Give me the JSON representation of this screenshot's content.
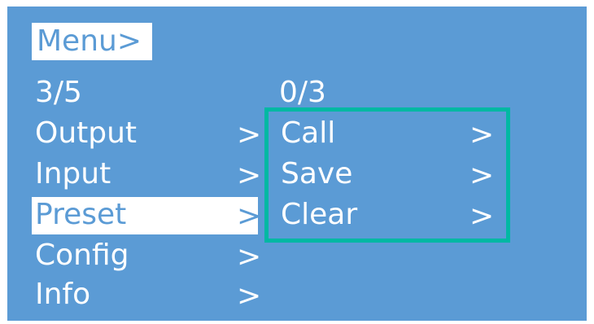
{
  "menu": {
    "title": "Menu>",
    "counter": "3/5",
    "items": [
      {
        "label": "Output",
        "arrow": ">"
      },
      {
        "label": "Input",
        "arrow": ">"
      },
      {
        "label": "Preset",
        "arrow": ">"
      },
      {
        "label": "Config",
        "arrow": ">"
      },
      {
        "label": "Info",
        "arrow": ">"
      }
    ],
    "selected_index": 2
  },
  "submenu": {
    "counter": "0/3",
    "items": [
      {
        "label": "Call",
        "arrow": ">"
      },
      {
        "label": "Save",
        "arrow": ">"
      },
      {
        "label": "Clear",
        "arrow": ">"
      }
    ]
  },
  "colors": {
    "screen_background": "#5b9bd5",
    "text": "#ffffff",
    "highlight_box": "#00b8a3"
  }
}
